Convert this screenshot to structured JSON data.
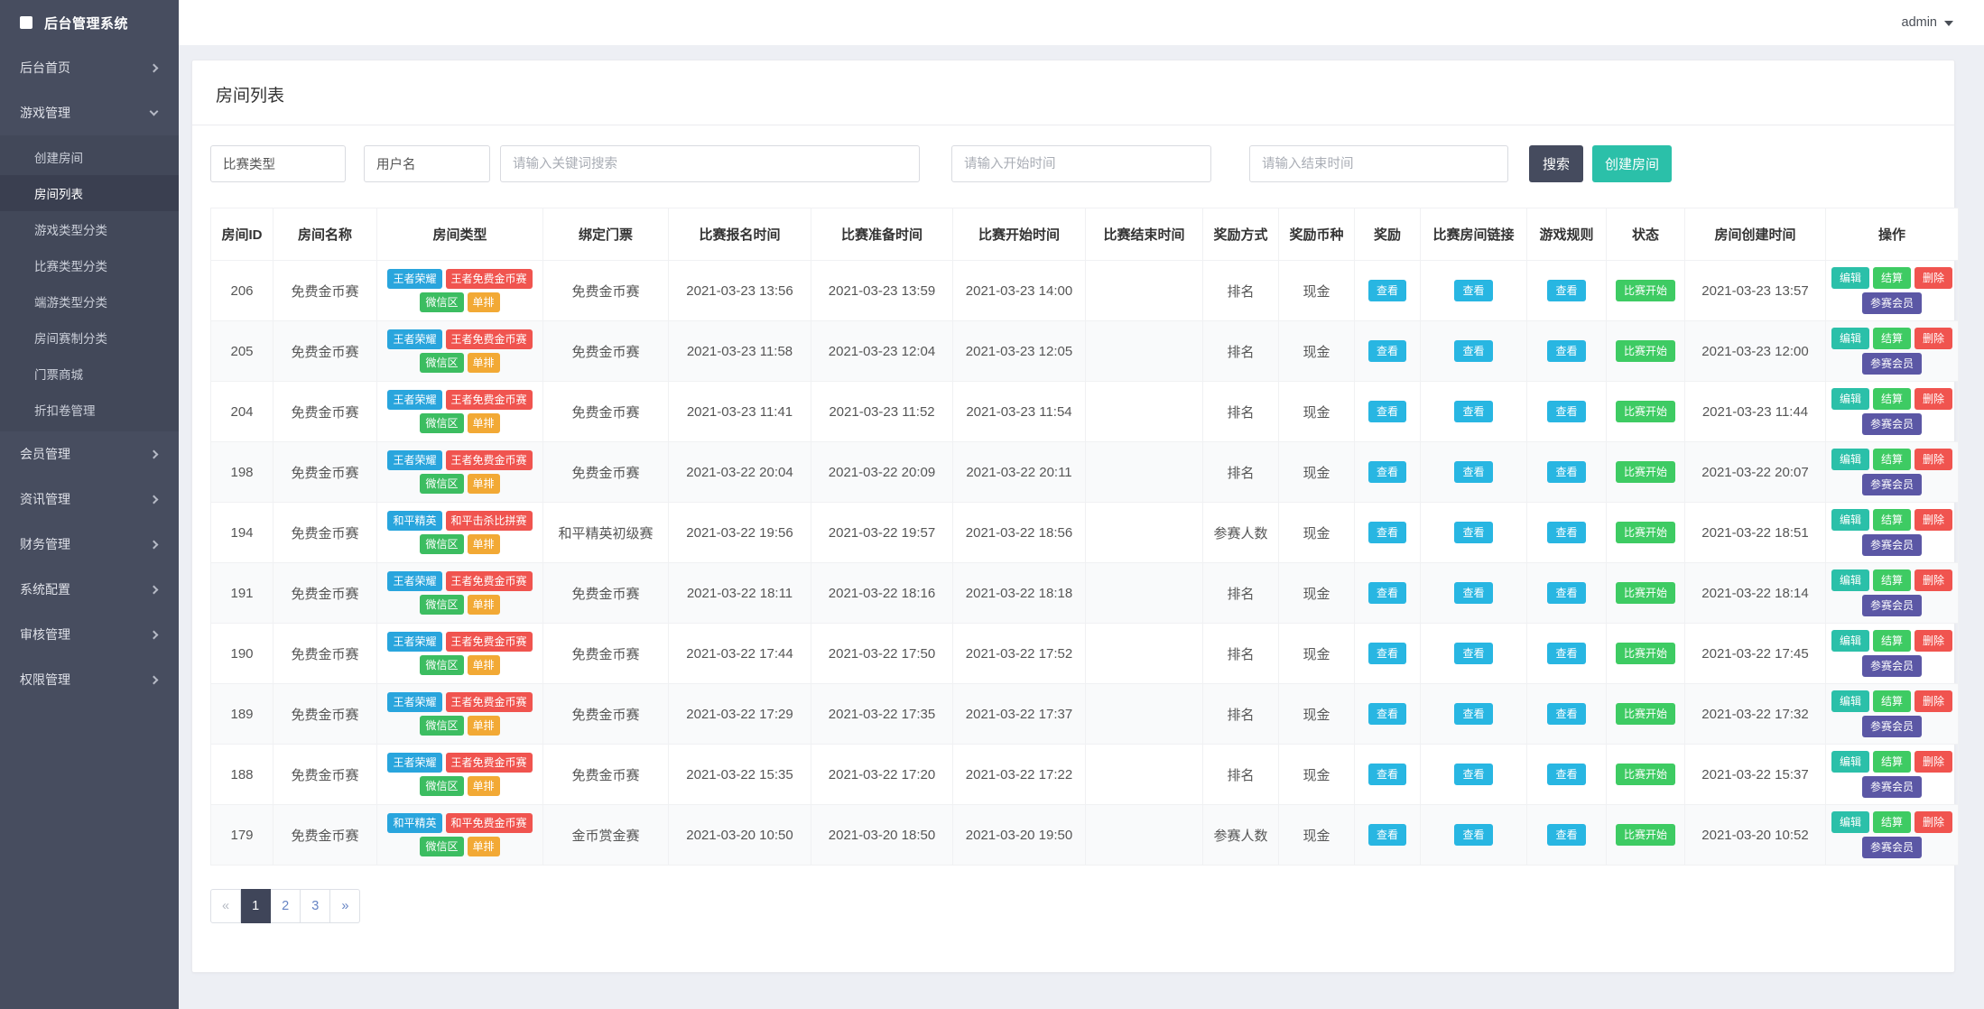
{
  "app": {
    "brand": "后台管理系统",
    "user": "admin"
  },
  "sidebar": {
    "items": [
      {
        "label": "后台首页",
        "expanded": false
      },
      {
        "label": "游戏管理",
        "expanded": true,
        "children": [
          {
            "label": "创建房间",
            "active": false
          },
          {
            "label": "房间列表",
            "active": true
          },
          {
            "label": "游戏类型分类",
            "active": false
          },
          {
            "label": "比赛类型分类",
            "active": false
          },
          {
            "label": "端游类型分类",
            "active": false
          },
          {
            "label": "房间赛制分类",
            "active": false
          },
          {
            "label": "门票商城",
            "active": false
          },
          {
            "label": "折扣卷管理",
            "active": false
          }
        ]
      },
      {
        "label": "会员管理",
        "expanded": false
      },
      {
        "label": "资讯管理",
        "expanded": false
      },
      {
        "label": "财务管理",
        "expanded": false
      },
      {
        "label": "系统配置",
        "expanded": false
      },
      {
        "label": "审核管理",
        "expanded": false
      },
      {
        "label": "权限管理",
        "expanded": false
      }
    ]
  },
  "page": {
    "title": "房间列表"
  },
  "filters": {
    "match_type_value": "比赛类型",
    "username_value": "用户名",
    "keyword_placeholder": "请输入关键词搜索",
    "start_time_placeholder": "请输入开始时间",
    "end_time_placeholder": "请输入结束时间",
    "search_label": "搜索",
    "create_label": "创建房间"
  },
  "table": {
    "columns": [
      "房间ID",
      "房间名称",
      "房间类型",
      "绑定门票",
      "比赛报名时间",
      "比赛准备时间",
      "比赛开始时间",
      "比赛结束时间",
      "奖励方式",
      "奖励币种",
      "奖励",
      "比赛房间链接",
      "游戏规则",
      "状态",
      "房间创建时间",
      "操作"
    ],
    "labels": {
      "view": "查看",
      "status": "比赛开始",
      "edit": "编辑",
      "settle": "结算",
      "delete": "删除",
      "members": "参赛会员"
    },
    "rows": [
      {
        "id": "206",
        "name": "免费金币赛",
        "badges": [
          {
            "text": "王者荣耀",
            "color": "blue"
          },
          {
            "text": "王者免费金币赛",
            "color": "red"
          },
          {
            "text": "微信区",
            "color": "green"
          },
          {
            "text": "单排",
            "color": "orange"
          }
        ],
        "ticket": "免费金币赛",
        "signup": "2021-03-23 13:56",
        "ready": "2021-03-23 13:59",
        "start": "2021-03-23 14:00",
        "end": "",
        "reward_mode": "排名",
        "currency": "现金",
        "created": "2021-03-23 13:57"
      },
      {
        "id": "205",
        "name": "免费金币赛",
        "badges": [
          {
            "text": "王者荣耀",
            "color": "blue"
          },
          {
            "text": "王者免费金币赛",
            "color": "red"
          },
          {
            "text": "微信区",
            "color": "green"
          },
          {
            "text": "单排",
            "color": "orange"
          }
        ],
        "ticket": "免费金币赛",
        "signup": "2021-03-23 11:58",
        "ready": "2021-03-23 12:04",
        "start": "2021-03-23 12:05",
        "end": "",
        "reward_mode": "排名",
        "currency": "现金",
        "created": "2021-03-23 12:00"
      },
      {
        "id": "204",
        "name": "免费金币赛",
        "badges": [
          {
            "text": "王者荣耀",
            "color": "blue"
          },
          {
            "text": "王者免费金币赛",
            "color": "red"
          },
          {
            "text": "微信区",
            "color": "green"
          },
          {
            "text": "单排",
            "color": "orange"
          }
        ],
        "ticket": "免费金币赛",
        "signup": "2021-03-23 11:41",
        "ready": "2021-03-23 11:52",
        "start": "2021-03-23 11:54",
        "end": "",
        "reward_mode": "排名",
        "currency": "现金",
        "created": "2021-03-23 11:44"
      },
      {
        "id": "198",
        "name": "免费金币赛",
        "badges": [
          {
            "text": "王者荣耀",
            "color": "blue"
          },
          {
            "text": "王者免费金币赛",
            "color": "red"
          },
          {
            "text": "微信区",
            "color": "green"
          },
          {
            "text": "单排",
            "color": "orange"
          }
        ],
        "ticket": "免费金币赛",
        "signup": "2021-03-22 20:04",
        "ready": "2021-03-22 20:09",
        "start": "2021-03-22 20:11",
        "end": "",
        "reward_mode": "排名",
        "currency": "现金",
        "created": "2021-03-22 20:07"
      },
      {
        "id": "194",
        "name": "免费金币赛",
        "badges": [
          {
            "text": "和平精英",
            "color": "blue"
          },
          {
            "text": "和平击杀比拼赛",
            "color": "red"
          },
          {
            "text": "微信区",
            "color": "green"
          },
          {
            "text": "单排",
            "color": "orange"
          }
        ],
        "ticket": "和平精英初级赛",
        "signup": "2021-03-22 19:56",
        "ready": "2021-03-22 19:57",
        "start": "2021-03-22 18:56",
        "end": "",
        "reward_mode": "参赛人数",
        "currency": "现金",
        "created": "2021-03-22 18:51"
      },
      {
        "id": "191",
        "name": "免费金币赛",
        "badges": [
          {
            "text": "王者荣耀",
            "color": "blue"
          },
          {
            "text": "王者免费金币赛",
            "color": "red"
          },
          {
            "text": "微信区",
            "color": "green"
          },
          {
            "text": "单排",
            "color": "orange"
          }
        ],
        "ticket": "免费金币赛",
        "signup": "2021-03-22 18:11",
        "ready": "2021-03-22 18:16",
        "start": "2021-03-22 18:18",
        "end": "",
        "reward_mode": "排名",
        "currency": "现金",
        "created": "2021-03-22 18:14"
      },
      {
        "id": "190",
        "name": "免费金币赛",
        "badges": [
          {
            "text": "王者荣耀",
            "color": "blue"
          },
          {
            "text": "王者免费金币赛",
            "color": "red"
          },
          {
            "text": "微信区",
            "color": "green"
          },
          {
            "text": "单排",
            "color": "orange"
          }
        ],
        "ticket": "免费金币赛",
        "signup": "2021-03-22 17:44",
        "ready": "2021-03-22 17:50",
        "start": "2021-03-22 17:52",
        "end": "",
        "reward_mode": "排名",
        "currency": "现金",
        "created": "2021-03-22 17:45"
      },
      {
        "id": "189",
        "name": "免费金币赛",
        "badges": [
          {
            "text": "王者荣耀",
            "color": "blue"
          },
          {
            "text": "王者免费金币赛",
            "color": "red"
          },
          {
            "text": "微信区",
            "color": "green"
          },
          {
            "text": "单排",
            "color": "orange"
          }
        ],
        "ticket": "免费金币赛",
        "signup": "2021-03-22 17:29",
        "ready": "2021-03-22 17:35",
        "start": "2021-03-22 17:37",
        "end": "",
        "reward_mode": "排名",
        "currency": "现金",
        "created": "2021-03-22 17:32"
      },
      {
        "id": "188",
        "name": "免费金币赛",
        "badges": [
          {
            "text": "王者荣耀",
            "color": "blue"
          },
          {
            "text": "王者免费金币赛",
            "color": "red"
          },
          {
            "text": "微信区",
            "color": "green"
          },
          {
            "text": "单排",
            "color": "orange"
          }
        ],
        "ticket": "免费金币赛",
        "signup": "2021-03-22 15:35",
        "ready": "2021-03-22 17:20",
        "start": "2021-03-22 17:22",
        "end": "",
        "reward_mode": "排名",
        "currency": "现金",
        "created": "2021-03-22 15:37"
      },
      {
        "id": "179",
        "name": "免费金币赛",
        "badges": [
          {
            "text": "和平精英",
            "color": "blue"
          },
          {
            "text": "和平免费金币赛",
            "color": "red"
          },
          {
            "text": "微信区",
            "color": "green"
          },
          {
            "text": "单排",
            "color": "orange"
          }
        ],
        "ticket": "金币赏金赛",
        "signup": "2021-03-20 10:50",
        "ready": "2021-03-20 18:50",
        "start": "2021-03-20 19:50",
        "end": "",
        "reward_mode": "参赛人数",
        "currency": "现金",
        "created": "2021-03-20 10:52"
      }
    ]
  },
  "pagination": {
    "items": [
      {
        "label": "«",
        "kind": "prev",
        "active": false
      },
      {
        "label": "1",
        "kind": "page",
        "active": true
      },
      {
        "label": "2",
        "kind": "page",
        "active": false
      },
      {
        "label": "3",
        "kind": "page",
        "active": false
      },
      {
        "label": "»",
        "kind": "next",
        "active": false
      }
    ]
  },
  "colors": {
    "sidebar_bg": "#474d5f",
    "sidebar_sub_bg": "#424859",
    "sidebar_active_bg": "#3a3f50",
    "accent_teal": "#2bc0a9",
    "dark_slate": "#454b5e",
    "cyan_button": "#28b6e2",
    "green_button": "#3ecb63",
    "red_button": "#f0544f",
    "indigo_button": "#5b57a5",
    "badge_blue": "#29a5dd",
    "badge_orange": "#f2a935",
    "badge_green": "#3cbd61",
    "page_bg": "#edeff4",
    "link_blue": "#6684c4"
  }
}
